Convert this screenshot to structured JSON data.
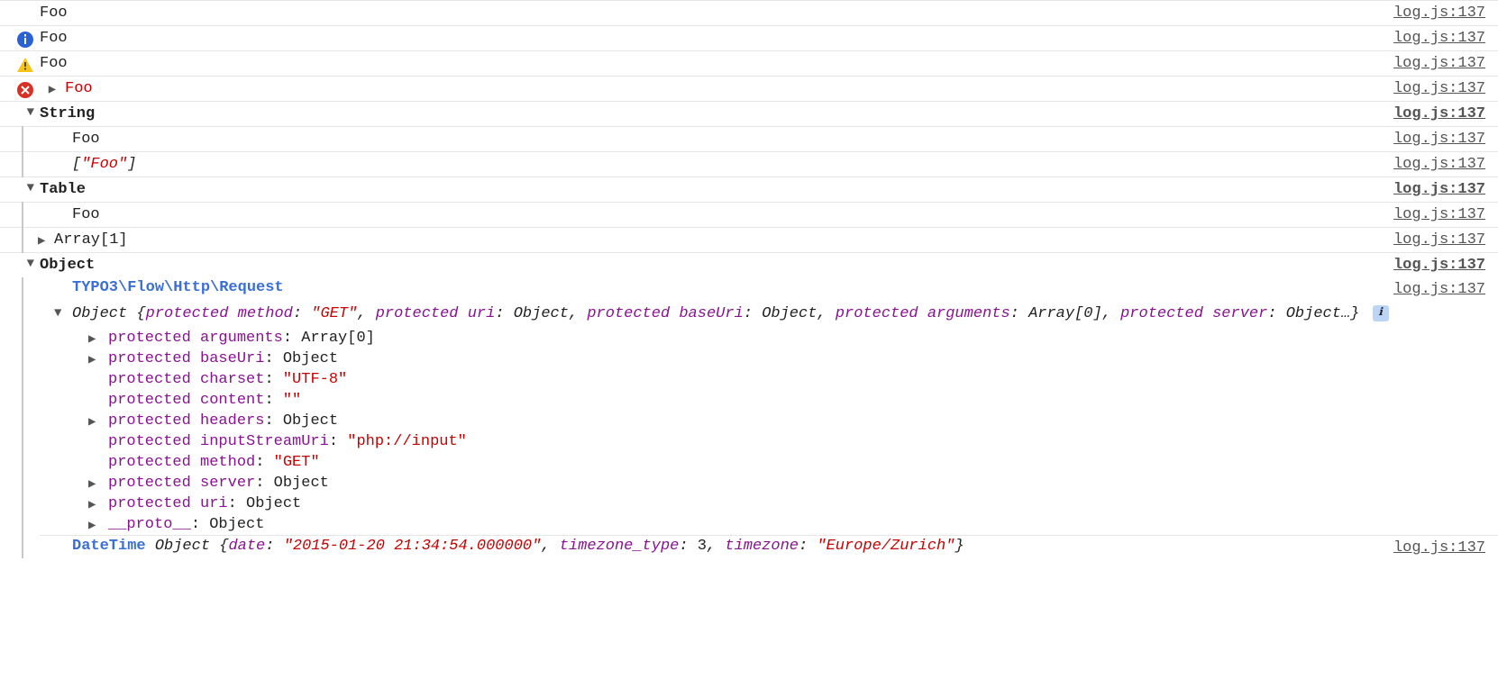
{
  "source_link": "log.js:137",
  "rows": {
    "r1": "Foo",
    "r2": "Foo",
    "r3": "Foo",
    "r4": "Foo"
  },
  "groups": {
    "string": {
      "label": "String",
      "child1": "Foo",
      "child2_bracket_open": "[",
      "child2_value": "\"Foo\"",
      "child2_bracket_close": "]"
    },
    "table": {
      "label": "Table",
      "child1": "Foo",
      "child2_prefix": "Array",
      "child2_suffix": "[1]"
    },
    "object": {
      "label": "Object"
    }
  },
  "request_heading": "TYPO3\\Flow\\Http\\Request",
  "obj_summary": {
    "prefix": "Object",
    "open": "{",
    "p1k": "protected method",
    "p1v": "\"GET\"",
    "p2k": "protected uri",
    "p2v": "Object",
    "p3k": "protected baseUri",
    "p3v": "Object",
    "p4k": "protected arguments",
    "p4v": "Array[0]",
    "p5k": "protected server",
    "p5v": "Object…",
    "close": "}"
  },
  "props": {
    "arguments": {
      "k": "protected arguments",
      "v": "Array[0]"
    },
    "baseUri": {
      "k": "protected baseUri",
      "v": "Object"
    },
    "charset": {
      "k": "protected charset",
      "v": "\"UTF-8\""
    },
    "content": {
      "k": "protected content",
      "v": "\"\""
    },
    "headers": {
      "k": "protected headers",
      "v": "Object"
    },
    "inputStreamUri": {
      "k": "protected inputStreamUri",
      "v": "\"php://input\""
    },
    "method": {
      "k": "protected method",
      "v": "\"GET\""
    },
    "server": {
      "k": "protected server",
      "v": "Object"
    },
    "uri": {
      "k": "protected uri",
      "v": "Object"
    },
    "proto": {
      "k": "__proto__",
      "v": "Object"
    }
  },
  "datetime": {
    "label": "DateTime",
    "prefix": "Object",
    "open": "{",
    "k1": "date",
    "v1": "\"2015-01-20 21:34:54.000000\"",
    "k2": "timezone_type",
    "v2": "3",
    "k3": "timezone",
    "v3": "\"Europe/Zurich\"",
    "close": "}"
  }
}
